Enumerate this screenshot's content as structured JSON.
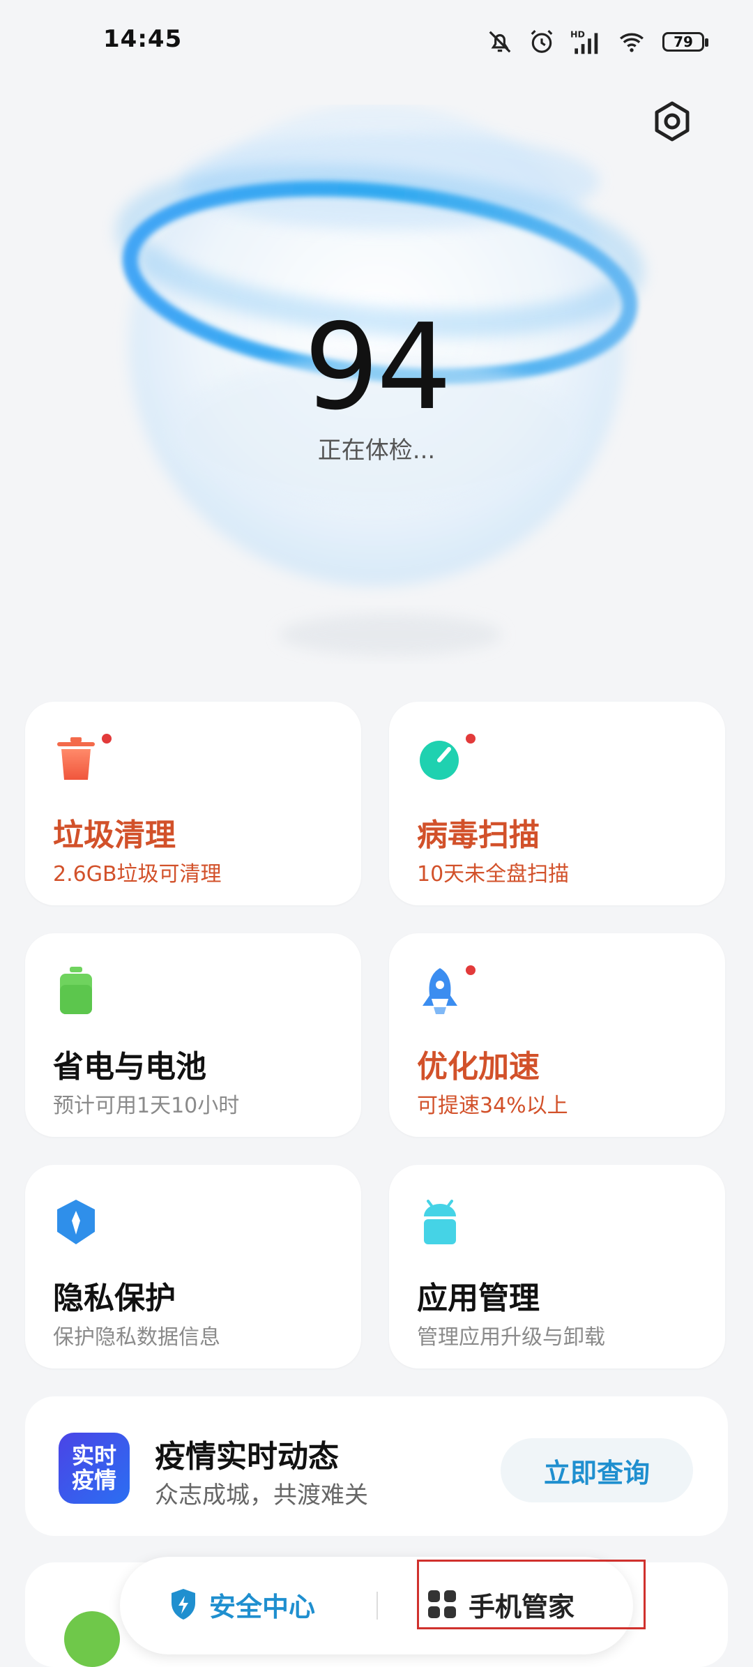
{
  "status_bar": {
    "time": "14:45",
    "battery": "79",
    "icons": [
      "mute-icon",
      "alarm-icon",
      "hd-signal-icon",
      "wifi-icon",
      "battery-icon"
    ]
  },
  "header": {
    "settings_icon": "settings-hex-icon"
  },
  "hero": {
    "score": "94",
    "label": "正在体检..."
  },
  "cards": [
    {
      "title": "垃圾清理",
      "subtitle": "2.6GB垃圾可清理",
      "icon": "trash-icon",
      "color": "#f26b4e"
    },
    {
      "title": "病毒扫描",
      "subtitle": "10天未全盘扫描",
      "icon": "virus-scan-icon",
      "color": "#1fd1b0"
    },
    {
      "title": "省电与电池",
      "subtitle": "预计可用1天10小时",
      "icon": "battery-saver-icon",
      "color": "#6fd35e"
    },
    {
      "title": "优化加速",
      "subtitle": "可提速34%以上",
      "icon": "rocket-icon",
      "color": "#3b8df0"
    },
    {
      "title": "隐私保护",
      "subtitle": "保护隐私数据信息",
      "icon": "privacy-shield-icon",
      "color": "#2f8fea"
    },
    {
      "title": "应用管理",
      "subtitle": "管理应用升级与卸载",
      "icon": "android-app-icon",
      "color": "#45d3e6"
    }
  ],
  "banner": {
    "icon_line1": "实时",
    "icon_line2": "疫情",
    "title": "疫情实时动态",
    "subtitle": "众志成城，共渡难关",
    "button": "立即查询"
  },
  "bottom_nav": {
    "items": [
      {
        "label": "安全中心",
        "icon": "shield-lightning-icon"
      },
      {
        "label": "手机管家",
        "icon": "grid-apps-icon"
      }
    ]
  },
  "colors": {
    "accent": "#1f8fcf",
    "warning": "#d2512a",
    "red_dot": "#e23a3a"
  }
}
